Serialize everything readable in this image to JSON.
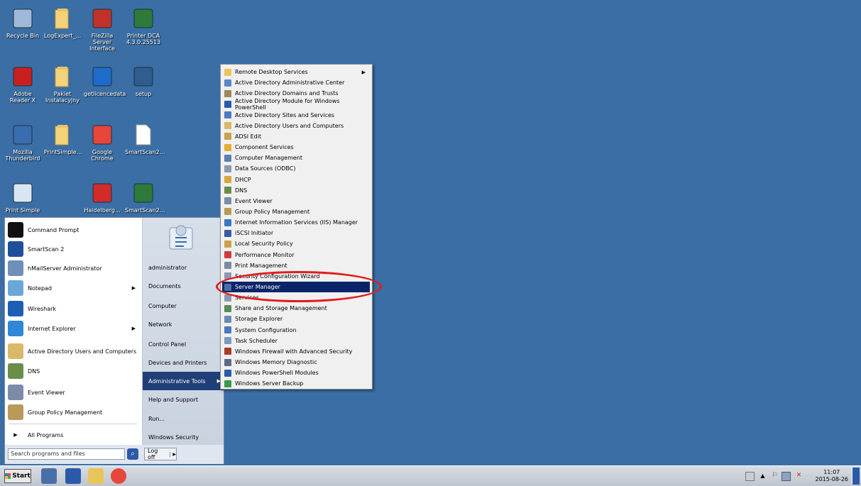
{
  "desktop": {
    "icons": [
      {
        "label": "Recycle Bin",
        "icon": "recycle-bin-icon",
        "color": "#9fb8d8"
      },
      {
        "label": "LogExpert_...",
        "icon": "folder-icon",
        "color": "#f4d37a"
      },
      {
        "label": "FileZilla Server Interface",
        "icon": "filezilla-icon",
        "color": "#c0322a"
      },
      {
        "label": "Printer DCA 4.3.0.25513",
        "icon": "archive-icon",
        "color": "#2d7a3a"
      },
      {
        "label": "Adobe Reader X",
        "icon": "adobe-reader-icon",
        "color": "#c8201e"
      },
      {
        "label": "Pakiet Instalacyjny",
        "icon": "folder-icon",
        "color": "#f4d37a"
      },
      {
        "label": "getlicencedata",
        "icon": "butterfly-icon",
        "color": "#1d6cc9"
      },
      {
        "label": "setup",
        "icon": "setup-icon",
        "color": "#2e5d8e"
      },
      {
        "label": "Mozilla Thunderbird",
        "icon": "thunderbird-icon",
        "color": "#3a6cb0"
      },
      {
        "label": "PrintSimple...",
        "icon": "folder-icon",
        "color": "#f4d37a"
      },
      {
        "label": "Google Chrome",
        "icon": "chrome-icon",
        "color": "#e7463a"
      },
      {
        "label": "SmartScan2...",
        "icon": "file-icon",
        "color": "#ffffff"
      },
      {
        "label": "Print Simple",
        "icon": "document-icon",
        "color": "#d9e5f3"
      },
      {
        "label": "",
        "icon": "blank",
        "color": "#3a6ea5"
      },
      {
        "label": "Haidelberg...",
        "icon": "pdf-icon",
        "color": "#d32a2a"
      },
      {
        "label": "SmartScan2...",
        "icon": "archive-icon",
        "color": "#2d7a3a"
      }
    ]
  },
  "start_menu": {
    "left_items": [
      {
        "label": "Command Prompt",
        "icon": "cmd-icon",
        "color": "#111111",
        "arrow": ""
      },
      {
        "label": "SmartScan 2",
        "icon": "smartscan-icon",
        "color": "#1f4f9a",
        "arrow": ""
      },
      {
        "label": "hMailServer Administrator",
        "icon": "mail-server-icon",
        "color": "#6e8fb8",
        "arrow": ""
      },
      {
        "label": "Notepad",
        "icon": "notepad-icon",
        "color": "#6aa8d8",
        "arrow": "▶"
      },
      {
        "label": "Wireshark",
        "icon": "wireshark-icon",
        "color": "#1d5fb4",
        "arrow": ""
      },
      {
        "label": "Internet Explorer",
        "icon": "ie-icon",
        "color": "#2f88d6",
        "arrow": "▶"
      },
      {
        "label": "Active Directory Users and Computers",
        "icon": "ad-users-icon",
        "color": "#d9b86a",
        "arrow": ""
      },
      {
        "label": "DNS",
        "icon": "dns-icon",
        "color": "#6a8d4a",
        "arrow": ""
      },
      {
        "label": "Event Viewer",
        "icon": "event-viewer-icon",
        "color": "#7c8ca8",
        "arrow": ""
      },
      {
        "label": "Group Policy Management",
        "icon": "group-policy-icon",
        "color": "#b99a5a",
        "arrow": ""
      }
    ],
    "all_programs": "All Programs",
    "right_items": [
      {
        "label": "administrator",
        "arrow": "",
        "active": false
      },
      {
        "label": "Documents",
        "arrow": "",
        "active": false
      },
      {
        "label": "Computer",
        "arrow": "",
        "active": false
      },
      {
        "label": "Network",
        "arrow": "",
        "active": false
      },
      {
        "label": "Control Panel",
        "arrow": "",
        "active": false
      },
      {
        "label": "Devices and Printers",
        "arrow": "",
        "active": false
      },
      {
        "label": "Administrative Tools",
        "arrow": "▶",
        "active": true
      },
      {
        "label": "Help and Support",
        "arrow": "",
        "active": false
      },
      {
        "label": "Run...",
        "arrow": "",
        "active": false
      },
      {
        "label": "Windows Security",
        "arrow": "",
        "active": false
      }
    ],
    "search_placeholder": "Search programs and files",
    "logoff_label": "Log off",
    "logoff_arrow": "▶"
  },
  "admin_tools": {
    "items": [
      {
        "label": "Remote Desktop Services",
        "color": "#e8c45a",
        "arrow": "▶",
        "selected": false
      },
      {
        "label": "Active Directory Administrative Center",
        "color": "#5b87c4",
        "arrow": "",
        "selected": false
      },
      {
        "label": "Active Directory Domains and Trusts",
        "color": "#9a8a5a",
        "arrow": "",
        "selected": false
      },
      {
        "label": "Active Directory Module for Windows PowerShell",
        "color": "#2a5aa8",
        "arrow": "",
        "selected": false
      },
      {
        "label": "Active Directory Sites and Services",
        "color": "#4a7cc0",
        "arrow": "",
        "selected": false
      },
      {
        "label": "Active Directory Users and Computers",
        "color": "#d9b86a",
        "arrow": "",
        "selected": false
      },
      {
        "label": "ADSI Edit",
        "color": "#c9a24a",
        "arrow": "",
        "selected": false
      },
      {
        "label": "Component Services",
        "color": "#e0b030",
        "arrow": "",
        "selected": false
      },
      {
        "label": "Computer Management",
        "color": "#5a7fb0",
        "arrow": "",
        "selected": false
      },
      {
        "label": "Data Sources (ODBC)",
        "color": "#8a9ab0",
        "arrow": "",
        "selected": false
      },
      {
        "label": "DHCP",
        "color": "#d4a83a",
        "arrow": "",
        "selected": false
      },
      {
        "label": "DNS",
        "color": "#6a8d4a",
        "arrow": "",
        "selected": false
      },
      {
        "label": "Event Viewer",
        "color": "#7c8ca8",
        "arrow": "",
        "selected": false
      },
      {
        "label": "Group Policy Management",
        "color": "#b99a5a",
        "arrow": "",
        "selected": false
      },
      {
        "label": "Internet Information Services (IIS) Manager",
        "color": "#3a78c0",
        "arrow": "",
        "selected": false
      },
      {
        "label": "iSCSI Initiator",
        "color": "#3a5aa0",
        "arrow": "",
        "selected": false
      },
      {
        "label": "Local Security Policy",
        "color": "#c9a24a",
        "arrow": "",
        "selected": false
      },
      {
        "label": "Performance Monitor",
        "color": "#d43a3a",
        "arrow": "",
        "selected": false
      },
      {
        "label": "Print Management",
        "color": "#7a8aa0",
        "arrow": "",
        "selected": false
      },
      {
        "label": "Security Configuration Wizard",
        "color": "#8a9ab0",
        "arrow": "",
        "selected": false
      },
      {
        "label": "Server Manager",
        "color": "#4a6ea8",
        "arrow": "",
        "selected": true
      },
      {
        "label": "Services",
        "color": "#8a9ab0",
        "arrow": "",
        "selected": false
      },
      {
        "label": "Share and Storage Management",
        "color": "#5a8a5a",
        "arrow": "",
        "selected": false
      },
      {
        "label": "Storage Explorer",
        "color": "#6a8ab0",
        "arrow": "",
        "selected": false
      },
      {
        "label": "System Configuration",
        "color": "#4a7ab8",
        "arrow": "",
        "selected": false
      },
      {
        "label": "Task Scheduler",
        "color": "#7a9ac0",
        "arrow": "",
        "selected": false
      },
      {
        "label": "Windows Firewall with Advanced Security",
        "color": "#a83a2a",
        "arrow": "",
        "selected": false
      },
      {
        "label": "Windows Memory Diagnostic",
        "color": "#5a6a80",
        "arrow": "",
        "selected": false
      },
      {
        "label": "Windows PowerShell Modules",
        "color": "#2a5aa8",
        "arrow": "",
        "selected": false
      },
      {
        "label": "Windows Server Backup",
        "color": "#3a9a4a",
        "arrow": "",
        "selected": false
      }
    ]
  },
  "taskbar": {
    "start_label": "Start",
    "apps": [
      {
        "name": "server-manager-taskbar",
        "color": "#4a6ea8"
      },
      {
        "name": "powershell-taskbar",
        "color": "#2a5aa8"
      },
      {
        "name": "explorer-taskbar",
        "color": "#e8c45a"
      },
      {
        "name": "chrome-taskbar",
        "color": "#e7463a"
      }
    ],
    "time": "11:07",
    "date": "2015-08-26"
  },
  "highlight_color": "#e21d1d"
}
